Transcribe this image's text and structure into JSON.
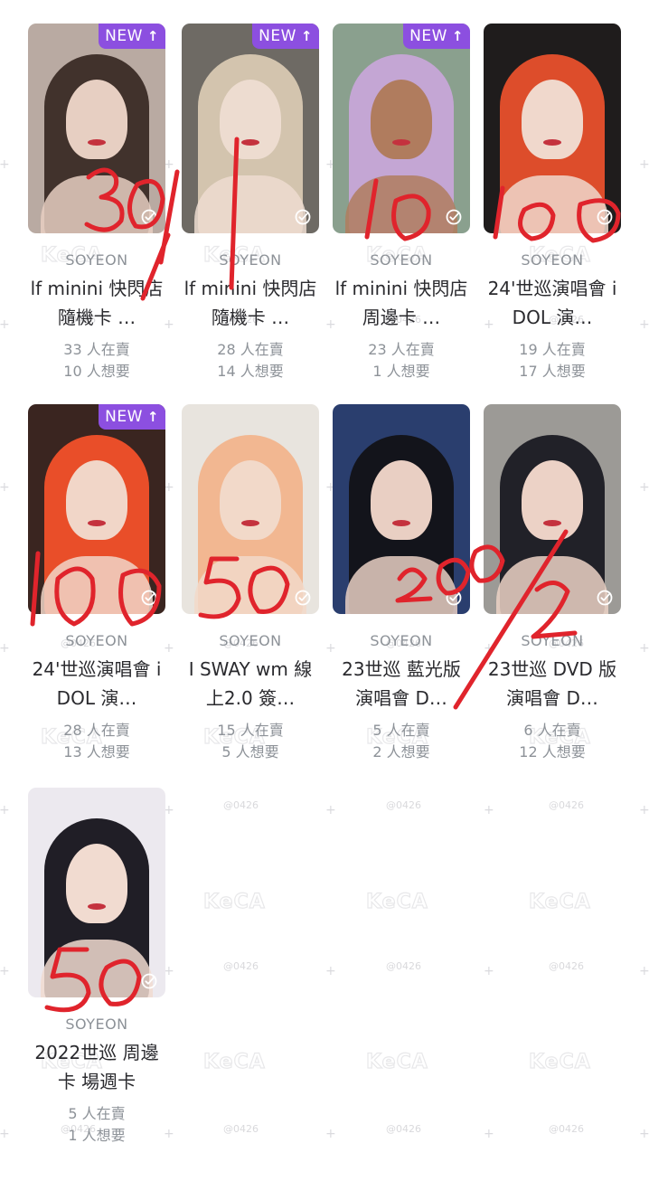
{
  "watermark": {
    "logo": "KeCA",
    "handle": "@0426"
  },
  "cards": [
    {
      "artist": "SOYEON",
      "title": "lf minini 快閃店 隨機卡 …",
      "selling": "33 人在賣",
      "wanting": "10 人想要",
      "is_new": true,
      "badge": "NEW",
      "photo_bg": "#b9aaa2",
      "photo_accent": "#3a2b26",
      "photo_skin": "#e7cfc2"
    },
    {
      "artist": "SOYEON",
      "title": "lf minini 快閃店 隨機卡 …",
      "selling": "28 人在賣",
      "wanting": "14 人想要",
      "is_new": true,
      "badge": "NEW",
      "photo_bg": "#6e6a64",
      "photo_accent": "#d8c9b2",
      "photo_skin": "#eddcd0"
    },
    {
      "artist": "SOYEON",
      "title": "lf minini 快閃店 周邊卡 …",
      "selling": "23 人在賣",
      "wanting": "1 人想要",
      "is_new": true,
      "badge": "NEW",
      "photo_bg": "#8aa08e",
      "photo_accent": "#c7a6d8",
      "photo_skin": "#b07c5e"
    },
    {
      "artist": "SOYEON",
      "title": "24'世巡演唱會 iDOL 演…",
      "selling": "19 人在賣",
      "wanting": "17 人想要",
      "is_new": false,
      "badge": "",
      "photo_bg": "#1f1c1c",
      "photo_accent": "#e8502c",
      "photo_skin": "#f0d8cc"
    },
    {
      "artist": "SOYEON",
      "title": "24'世巡演唱會 iDOL 演…",
      "selling": "28 人在賣",
      "wanting": "13 人想要",
      "is_new": true,
      "badge": "NEW",
      "photo_bg": "#3a2520",
      "photo_accent": "#f2502a",
      "photo_skin": "#f1d6c8"
    },
    {
      "artist": "SOYEON",
      "title": "I SWAY wm 線上2.0 簽…",
      "selling": "15 人在賣",
      "wanting": "5 人想要",
      "is_new": false,
      "badge": "",
      "photo_bg": "#e8e4de",
      "photo_accent": "#f2b48c",
      "photo_skin": "#f2d9c9"
    },
    {
      "artist": "SOYEON",
      "title": "23世巡 藍光版 演唱會 D…",
      "selling": "5 人在賣",
      "wanting": "2 人想要",
      "is_new": false,
      "badge": "",
      "photo_bg": "#2a3e6e",
      "photo_accent": "#121216",
      "photo_skin": "#e9cfc3"
    },
    {
      "artist": "SOYEON",
      "title": "23世巡 DVD 版 演唱會 D…",
      "selling": "6 人在賣",
      "wanting": "12 人想要",
      "is_new": false,
      "badge": "",
      "photo_bg": "#9c9a96",
      "photo_accent": "#1a1a22",
      "photo_skin": "#ecd2c6"
    },
    {
      "artist": "SOYEON",
      "title": "2022世巡 周邊卡 場週卡",
      "selling": "5 人在賣",
      "wanting": "1 人想要",
      "is_new": false,
      "badge": "",
      "photo_bg": "#ece9ef",
      "photo_accent": "#15131a",
      "photo_skin": "#f1dbd0"
    }
  ],
  "handwritten_notes": [
    "30",
    "1",
    "10",
    "100",
    "100",
    "50",
    "200",
    "2",
    "50"
  ],
  "colors": {
    "badge": "#8c4fe0",
    "muted_text": "#8d9298",
    "title_text": "#2a2a2e",
    "marker": "#e0242c"
  }
}
